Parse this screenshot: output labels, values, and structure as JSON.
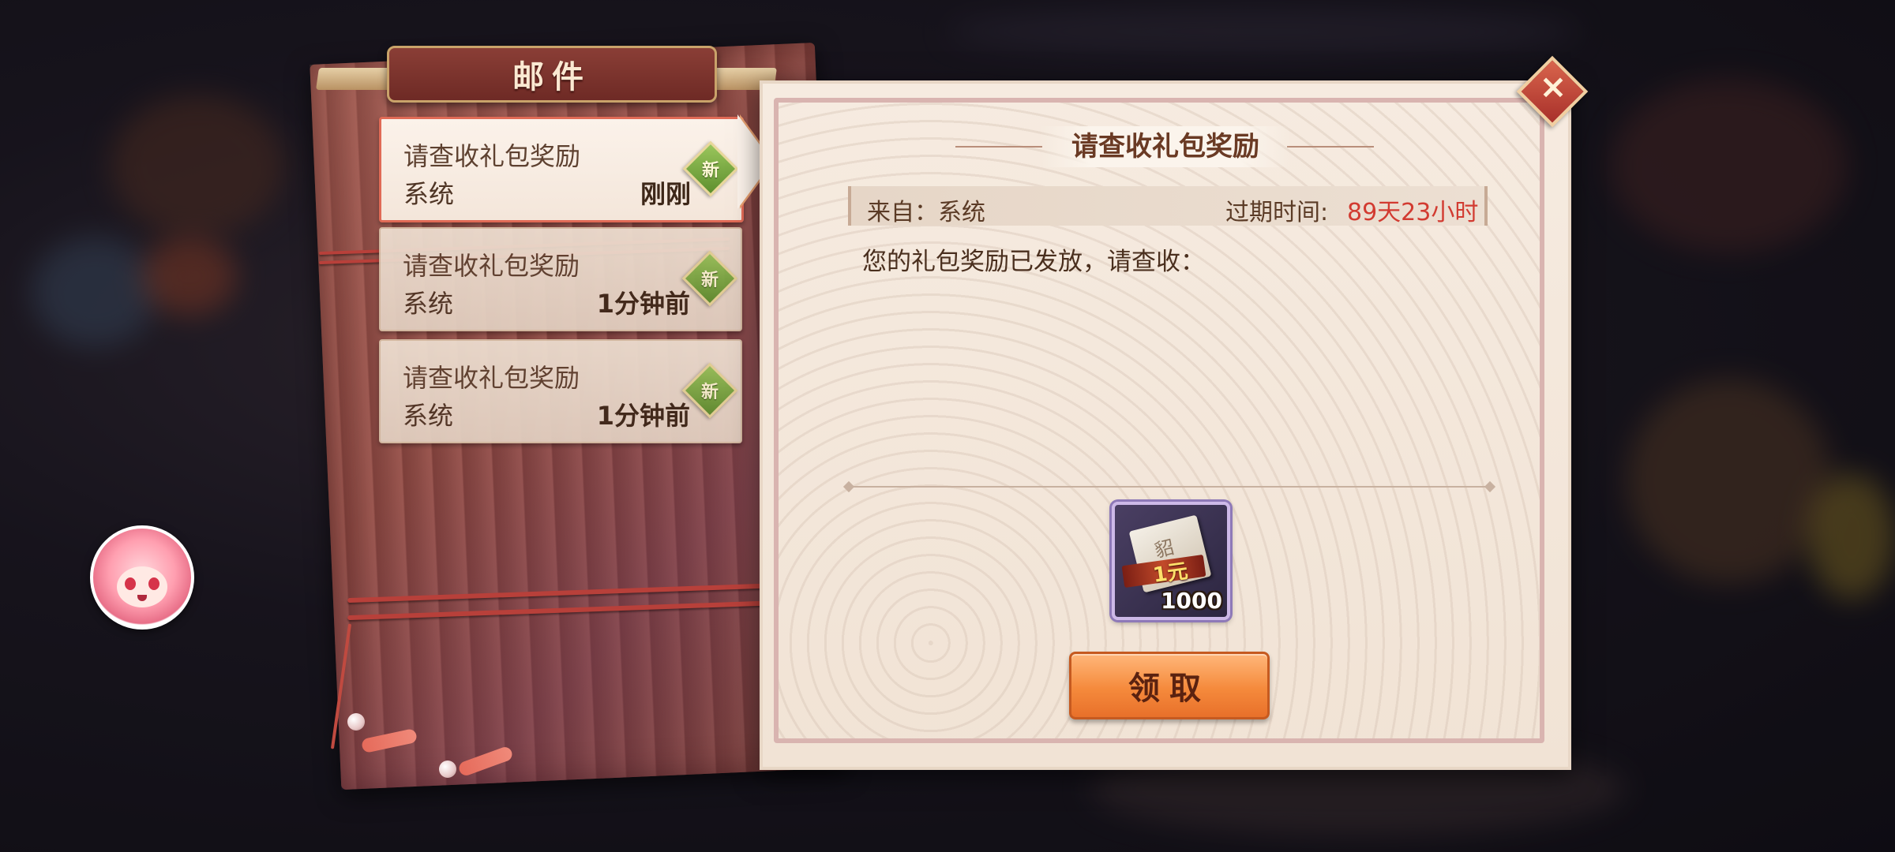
{
  "window": {
    "title": "邮件"
  },
  "mail_list": [
    {
      "subject": "请查收礼包奖励",
      "sender": "系统",
      "time": "刚刚",
      "badge": "新",
      "active": true
    },
    {
      "subject": "请查收礼包奖励",
      "sender": "系统",
      "time": "1分钟前",
      "badge": "新",
      "active": false
    },
    {
      "subject": "请查收礼包奖励",
      "sender": "系统",
      "time": "1分钟前",
      "badge": "新",
      "active": false
    }
  ],
  "detail": {
    "title": "请查收礼包奖励",
    "from_label": "来自：系统",
    "expire_label": "过期时间:",
    "expire_value": "89天23小时",
    "body": "您的礼包奖励已发放，请查收："
  },
  "reward": {
    "icon": "voucher-icon",
    "voucher_text": "1元",
    "paper_glyph": "貂",
    "quantity": "1000"
  },
  "actions": {
    "claim_label": "领取",
    "close_icon": "close-icon"
  },
  "colors": {
    "accent": "#f58a3c",
    "expire": "#d23b31",
    "new_badge": "#5e8f2e",
    "active_border": "#e06a56"
  }
}
